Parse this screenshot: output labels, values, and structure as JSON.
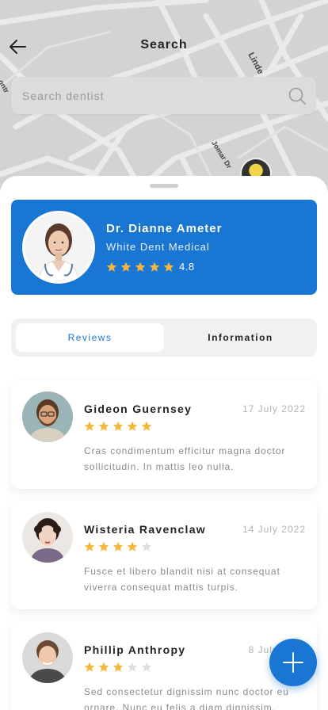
{
  "header": {
    "title": "Search"
  },
  "search": {
    "placeholder": "Search dentist"
  },
  "map": {
    "streets": [
      "Linde",
      "Jomar Dr",
      "ontr"
    ]
  },
  "doctor": {
    "name": "Dr. Dianne Ameter",
    "clinic": "White Dent Medical",
    "rating": "4.8",
    "stars": 5
  },
  "tabs": [
    {
      "label": "Reviews",
      "active": true
    },
    {
      "label": "Information",
      "active": false
    }
  ],
  "reviews": [
    {
      "name": "Gideon Guernsey",
      "date": "17 July 2022",
      "stars": 5,
      "text": "Cras condimentum efficitur magna doctor sollicitudin. In mattis leo nulla."
    },
    {
      "name": "Wisteria Ravenclaw",
      "date": "14 July 2022",
      "stars": 4,
      "text": "Fusce et libero blandit nisi at consequat viverra consequat mattis turpis."
    },
    {
      "name": "Phillip Anthropy",
      "date": "8 July 2022",
      "stars": 3,
      "text": "Sed consectetur dignissim nunc doctor eu ornare. Nunc eu felis a diam dignissim."
    }
  ],
  "colors": {
    "accent": "#1976d2",
    "star": "#f5b73b",
    "star_empty": "#e0e0e0"
  }
}
